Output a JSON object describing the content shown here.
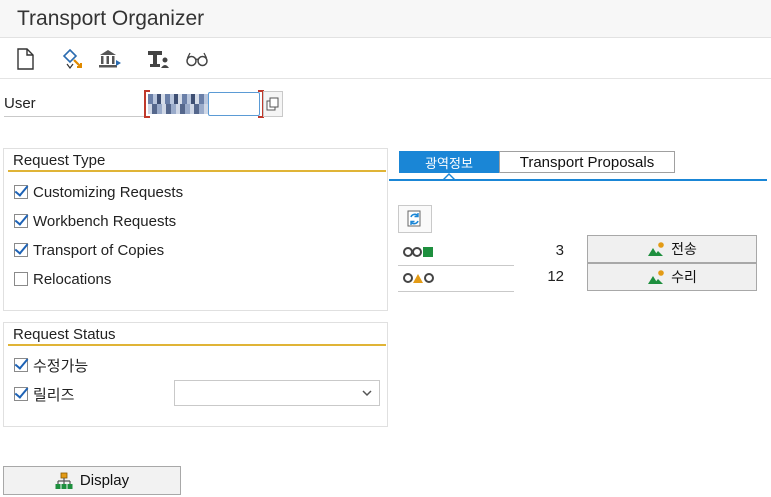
{
  "window": {
    "title": "Transport Organizer"
  },
  "toolbar": {
    "icons": [
      "new-document-icon",
      "diamond-arrow-icon",
      "bank-transfer-icon",
      "tool-user-icon",
      "glasses-icon"
    ]
  },
  "user": {
    "label": "User",
    "value": ""
  },
  "request_type": {
    "title": "Request Type",
    "items": [
      {
        "label": "Customizing Requests",
        "checked": true
      },
      {
        "label": "Workbench Requests",
        "checked": true
      },
      {
        "label": "Transport of Copies",
        "checked": true
      },
      {
        "label": "Relocations",
        "checked": false
      }
    ]
  },
  "request_status": {
    "title": "Request Status",
    "items": [
      {
        "label": "수정가능",
        "checked": true
      },
      {
        "label": "릴리즈",
        "checked": true
      }
    ],
    "select_value": ""
  },
  "tabs": [
    {
      "label": "광역정보",
      "active": true
    },
    {
      "label": "Transport Proposals",
      "active": false
    }
  ],
  "proposals": [
    {
      "icons": "circle-circle-square",
      "count": "3",
      "button": "전송"
    },
    {
      "icons": "circle-triangle-circle",
      "count": "12",
      "button": "수리"
    }
  ],
  "display_button": {
    "label": "Display"
  },
  "colors": {
    "accent_blue": "#1a86d6",
    "group_underline": "#e0b436",
    "check_blue": "#1d62b5",
    "green_square": "#1e8f3e",
    "orange_triangle": "#e39b16"
  }
}
